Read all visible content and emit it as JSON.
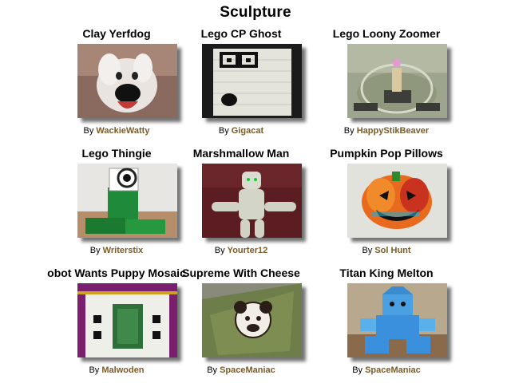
{
  "page": {
    "title": "Sculpture"
  },
  "by_prefix": "By",
  "colors": {
    "author_link": "#7a5c2a"
  },
  "items": [
    {
      "title": "Clay Yerfdog",
      "author": "WackieWatty"
    },
    {
      "title": "Lego CP Ghost",
      "author": "Gigacat"
    },
    {
      "title": "Lego Loony Zoomer",
      "author": "HappyStikBeaver"
    },
    {
      "title": "Lego Thingie",
      "author": "Writerstix"
    },
    {
      "title": "Marshmallow Man",
      "author": "Yourter12"
    },
    {
      "title": "Pumpkin Pop Pillows",
      "author": "Sol Hunt"
    },
    {
      "title": "obot Wants Puppy Mosaic",
      "author": "Malwoden"
    },
    {
      "title": "Supreme With Cheese",
      "author": "SpaceManiac"
    },
    {
      "title": "Titan King Melton",
      "author": "SpaceManiac"
    }
  ]
}
